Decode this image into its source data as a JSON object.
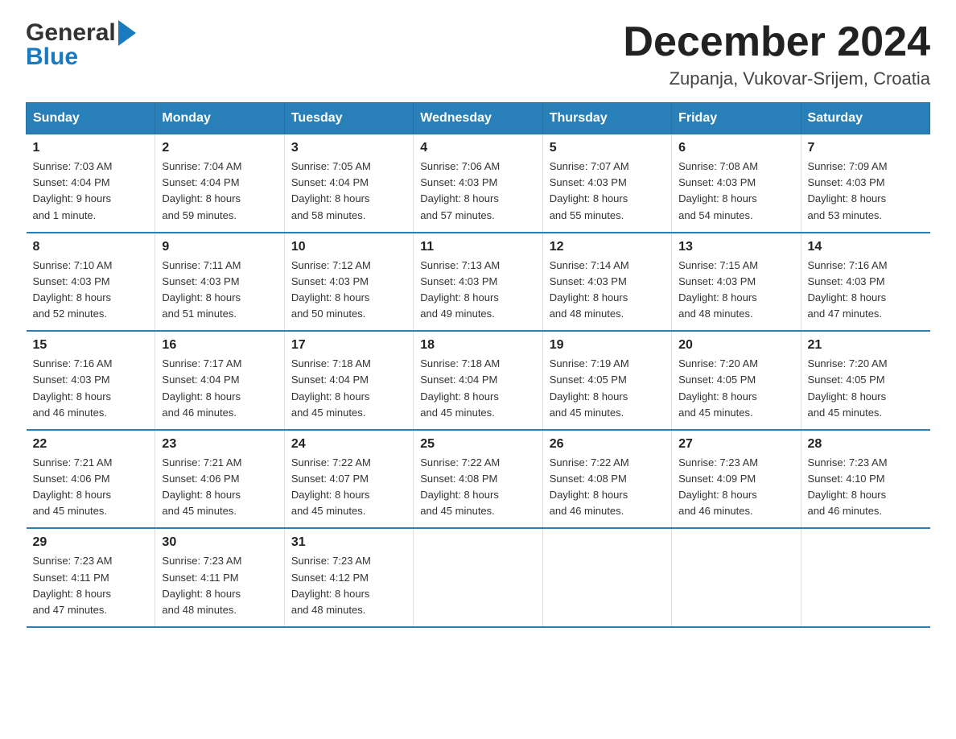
{
  "header": {
    "title": "December 2024",
    "subtitle": "Zupanja, Vukovar-Srijem, Croatia",
    "logo_general": "General",
    "logo_blue": "Blue"
  },
  "weekdays": [
    "Sunday",
    "Monday",
    "Tuesday",
    "Wednesday",
    "Thursday",
    "Friday",
    "Saturday"
  ],
  "weeks": [
    [
      {
        "day": "1",
        "sunrise": "7:03 AM",
        "sunset": "4:04 PM",
        "daylight": "9 hours and 1 minute."
      },
      {
        "day": "2",
        "sunrise": "7:04 AM",
        "sunset": "4:04 PM",
        "daylight": "8 hours and 59 minutes."
      },
      {
        "day": "3",
        "sunrise": "7:05 AM",
        "sunset": "4:04 PM",
        "daylight": "8 hours and 58 minutes."
      },
      {
        "day": "4",
        "sunrise": "7:06 AM",
        "sunset": "4:03 PM",
        "daylight": "8 hours and 57 minutes."
      },
      {
        "day": "5",
        "sunrise": "7:07 AM",
        "sunset": "4:03 PM",
        "daylight": "8 hours and 55 minutes."
      },
      {
        "day": "6",
        "sunrise": "7:08 AM",
        "sunset": "4:03 PM",
        "daylight": "8 hours and 54 minutes."
      },
      {
        "day": "7",
        "sunrise": "7:09 AM",
        "sunset": "4:03 PM",
        "daylight": "8 hours and 53 minutes."
      }
    ],
    [
      {
        "day": "8",
        "sunrise": "7:10 AM",
        "sunset": "4:03 PM",
        "daylight": "8 hours and 52 minutes."
      },
      {
        "day": "9",
        "sunrise": "7:11 AM",
        "sunset": "4:03 PM",
        "daylight": "8 hours and 51 minutes."
      },
      {
        "day": "10",
        "sunrise": "7:12 AM",
        "sunset": "4:03 PM",
        "daylight": "8 hours and 50 minutes."
      },
      {
        "day": "11",
        "sunrise": "7:13 AM",
        "sunset": "4:03 PM",
        "daylight": "8 hours and 49 minutes."
      },
      {
        "day": "12",
        "sunrise": "7:14 AM",
        "sunset": "4:03 PM",
        "daylight": "8 hours and 48 minutes."
      },
      {
        "day": "13",
        "sunrise": "7:15 AM",
        "sunset": "4:03 PM",
        "daylight": "8 hours and 48 minutes."
      },
      {
        "day": "14",
        "sunrise": "7:16 AM",
        "sunset": "4:03 PM",
        "daylight": "8 hours and 47 minutes."
      }
    ],
    [
      {
        "day": "15",
        "sunrise": "7:16 AM",
        "sunset": "4:03 PM",
        "daylight": "8 hours and 46 minutes."
      },
      {
        "day": "16",
        "sunrise": "7:17 AM",
        "sunset": "4:04 PM",
        "daylight": "8 hours and 46 minutes."
      },
      {
        "day": "17",
        "sunrise": "7:18 AM",
        "sunset": "4:04 PM",
        "daylight": "8 hours and 45 minutes."
      },
      {
        "day": "18",
        "sunrise": "7:18 AM",
        "sunset": "4:04 PM",
        "daylight": "8 hours and 45 minutes."
      },
      {
        "day": "19",
        "sunrise": "7:19 AM",
        "sunset": "4:05 PM",
        "daylight": "8 hours and 45 minutes."
      },
      {
        "day": "20",
        "sunrise": "7:20 AM",
        "sunset": "4:05 PM",
        "daylight": "8 hours and 45 minutes."
      },
      {
        "day": "21",
        "sunrise": "7:20 AM",
        "sunset": "4:05 PM",
        "daylight": "8 hours and 45 minutes."
      }
    ],
    [
      {
        "day": "22",
        "sunrise": "7:21 AM",
        "sunset": "4:06 PM",
        "daylight": "8 hours and 45 minutes."
      },
      {
        "day": "23",
        "sunrise": "7:21 AM",
        "sunset": "4:06 PM",
        "daylight": "8 hours and 45 minutes."
      },
      {
        "day": "24",
        "sunrise": "7:22 AM",
        "sunset": "4:07 PM",
        "daylight": "8 hours and 45 minutes."
      },
      {
        "day": "25",
        "sunrise": "7:22 AM",
        "sunset": "4:08 PM",
        "daylight": "8 hours and 45 minutes."
      },
      {
        "day": "26",
        "sunrise": "7:22 AM",
        "sunset": "4:08 PM",
        "daylight": "8 hours and 46 minutes."
      },
      {
        "day": "27",
        "sunrise": "7:23 AM",
        "sunset": "4:09 PM",
        "daylight": "8 hours and 46 minutes."
      },
      {
        "day": "28",
        "sunrise": "7:23 AM",
        "sunset": "4:10 PM",
        "daylight": "8 hours and 46 minutes."
      }
    ],
    [
      {
        "day": "29",
        "sunrise": "7:23 AM",
        "sunset": "4:11 PM",
        "daylight": "8 hours and 47 minutes."
      },
      {
        "day": "30",
        "sunrise": "7:23 AM",
        "sunset": "4:11 PM",
        "daylight": "8 hours and 48 minutes."
      },
      {
        "day": "31",
        "sunrise": "7:23 AM",
        "sunset": "4:12 PM",
        "daylight": "8 hours and 48 minutes."
      },
      null,
      null,
      null,
      null
    ]
  ],
  "labels": {
    "sunrise": "Sunrise:",
    "sunset": "Sunset:",
    "daylight": "Daylight:"
  }
}
